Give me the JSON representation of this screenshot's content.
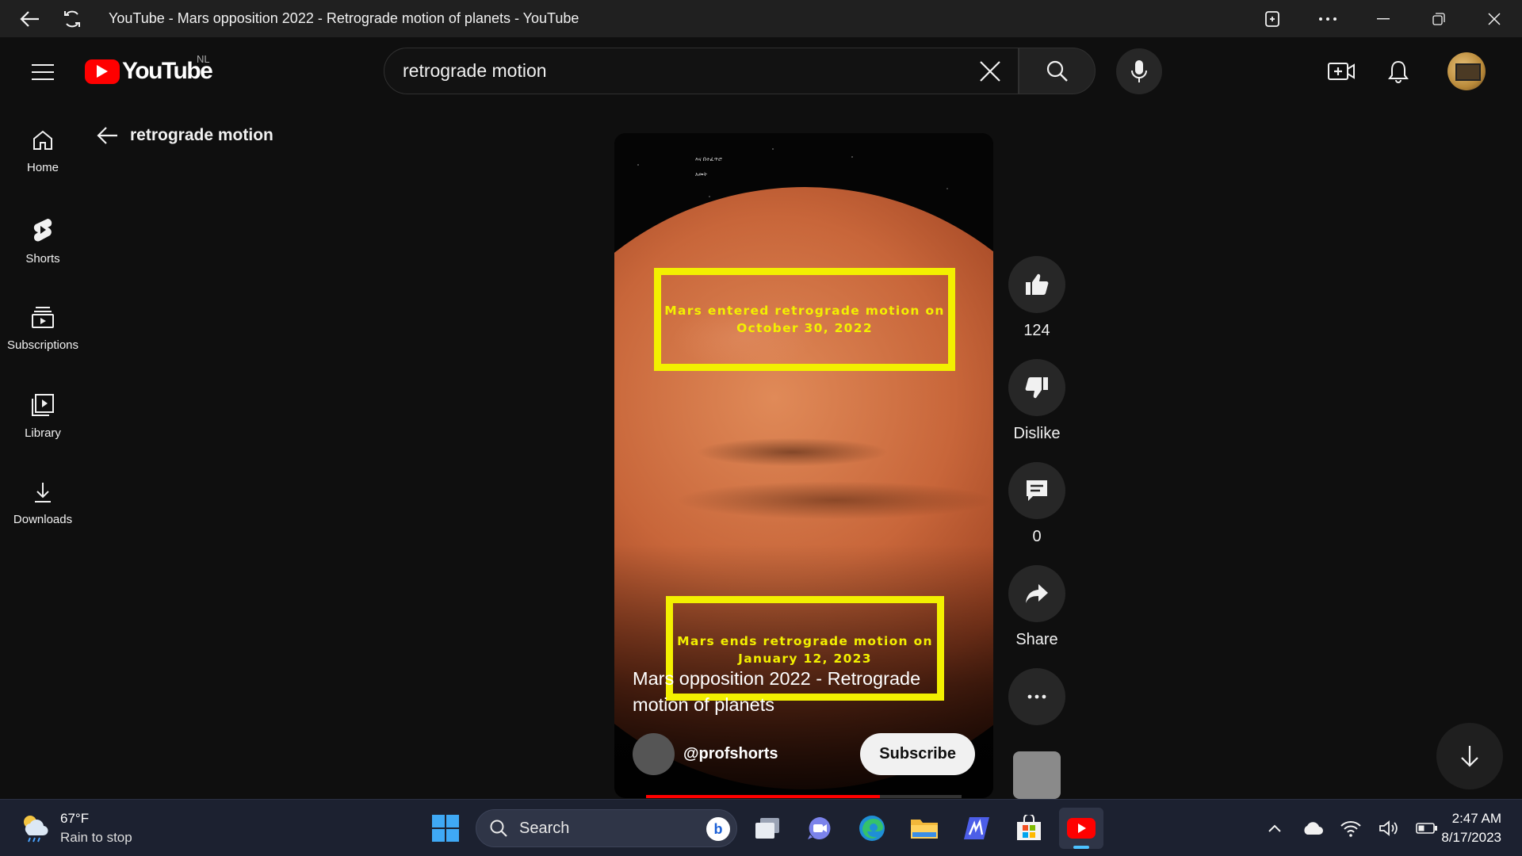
{
  "browser": {
    "title": "YouTube - Mars opposition 2022 - Retrograde motion of planets - YouTube"
  },
  "header": {
    "region": "NL",
    "logo_text": "YouTube",
    "search": {
      "value": "retrograde motion"
    }
  },
  "guide": {
    "items": [
      {
        "label": "Home",
        "icon": "home-icon"
      },
      {
        "label": "Shorts",
        "icon": "shorts-icon"
      },
      {
        "label": "Subscriptions",
        "icon": "subscriptions-icon"
      },
      {
        "label": "Library",
        "icon": "library-icon"
      },
      {
        "label": "Downloads",
        "icon": "download-icon"
      }
    ]
  },
  "back_query": "retrograde motion",
  "short": {
    "overlay_credit_1": "እና በተፈጥሮ",
    "overlay_credit_2": "አመት",
    "annotation_1": "Mars entered retrograde motion on October 30, 2022",
    "annotation_2": "Mars ends retrograde motion on January 12, 2023",
    "title": "Mars opposition 2022 - Retrograde motion of planets",
    "channel": "@profshorts",
    "subscribe_label": "Subscribe",
    "progress_fraction": 0.74
  },
  "actions": {
    "like_count": "124",
    "dislike_label": "Dislike",
    "comment_count": "0",
    "share_label": "Share"
  },
  "taskbar": {
    "weather_temp": "67°F",
    "weather_condition": "Rain to stop",
    "search_label": "Search",
    "time": "2:47 AM",
    "date": "8/17/2023"
  },
  "colors": {
    "youtube_red": "#ff0000",
    "annotation_yellow": "#f3f000",
    "background": "#0f0f0f"
  }
}
